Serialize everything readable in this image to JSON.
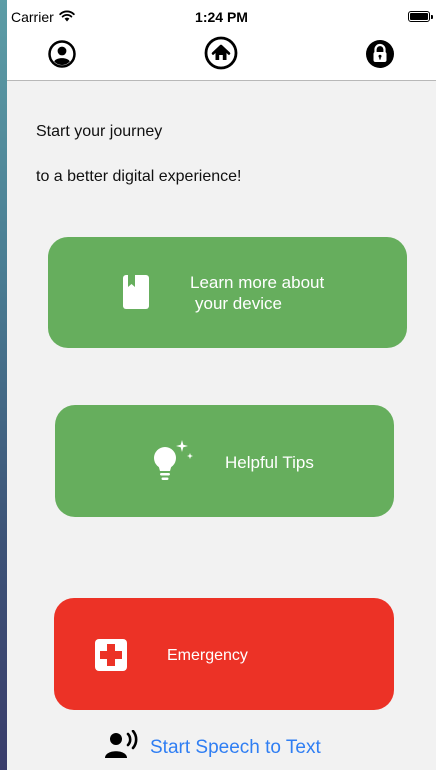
{
  "status_bar": {
    "carrier": "Carrier",
    "time": "1:24 PM",
    "icons": [
      "wifi-icon",
      "battery-icon"
    ]
  },
  "nav": {
    "profile_icon": "person-circle-icon",
    "home_icon": "house-circle-icon",
    "lock_icon": "lock-circle-icon"
  },
  "intro": {
    "line1": "Start your journey",
    "line2": "to a better digital experience!"
  },
  "cards": {
    "learn": {
      "line1": "Learn more about",
      "line2": "your device",
      "icon": "book-icon",
      "color": "#66ae5d"
    },
    "tips": {
      "label": "Helpful Tips",
      "icon": "lightbulb-icon",
      "color": "#66ae5d"
    },
    "emergency": {
      "label": "Emergency",
      "icon": "medical-cross-icon",
      "color": "#ec3226"
    }
  },
  "speech": {
    "label": "Start Speech to Text",
    "icon": "speaking-person-icon",
    "color": "#2f7ef3"
  }
}
